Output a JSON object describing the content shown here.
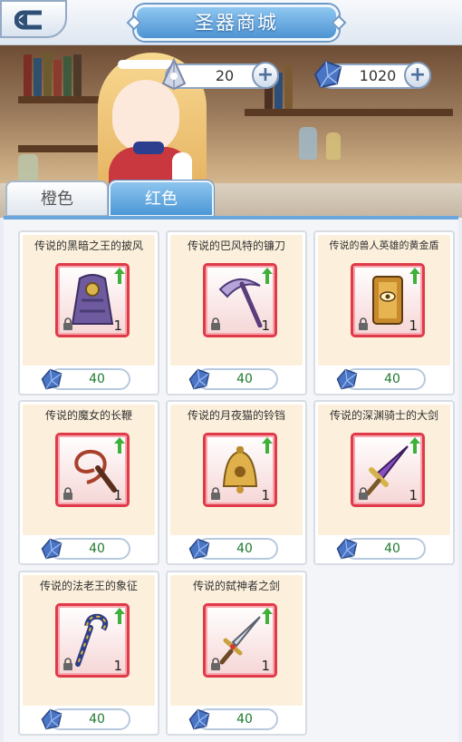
{
  "header": {
    "title": "圣器商城"
  },
  "currency": [
    {
      "icon": "crystal-currency-icon",
      "value": "20"
    },
    {
      "icon": "jewel-currency-icon",
      "value": "1020"
    }
  ],
  "tabs": [
    {
      "label": "橙色",
      "selected": false
    },
    {
      "label": "红色",
      "selected": true
    }
  ],
  "items": [
    {
      "name": "传说的黑暗之王的披风",
      "icon": "cloak-icon",
      "qty": "1",
      "price": "40"
    },
    {
      "name": "传说的巴风特的镰刀",
      "icon": "scythe-icon",
      "qty": "1",
      "price": "40"
    },
    {
      "name": "传说的兽人英雄的黄金盾",
      "icon": "shield-icon",
      "qty": "1",
      "price": "40"
    },
    {
      "name": "传说的魔女的长鞭",
      "icon": "whip-icon",
      "qty": "1",
      "price": "40"
    },
    {
      "name": "传说的月夜猫的铃铛",
      "icon": "bell-icon",
      "qty": "1",
      "price": "40"
    },
    {
      "name": "传说的深渊骑士的大剑",
      "icon": "greatsword-icon",
      "qty": "1",
      "price": "40"
    },
    {
      "name": "传说的法老王的象征",
      "icon": "scepter-icon",
      "qty": "1",
      "price": "40"
    },
    {
      "name": "传说的弑神者之剑",
      "icon": "sword-icon",
      "qty": "1",
      "price": "40"
    }
  ],
  "colors": {
    "accent": "#4c97d6",
    "item_frame": "#e03a4a",
    "price_text": "#1f7a2e"
  }
}
